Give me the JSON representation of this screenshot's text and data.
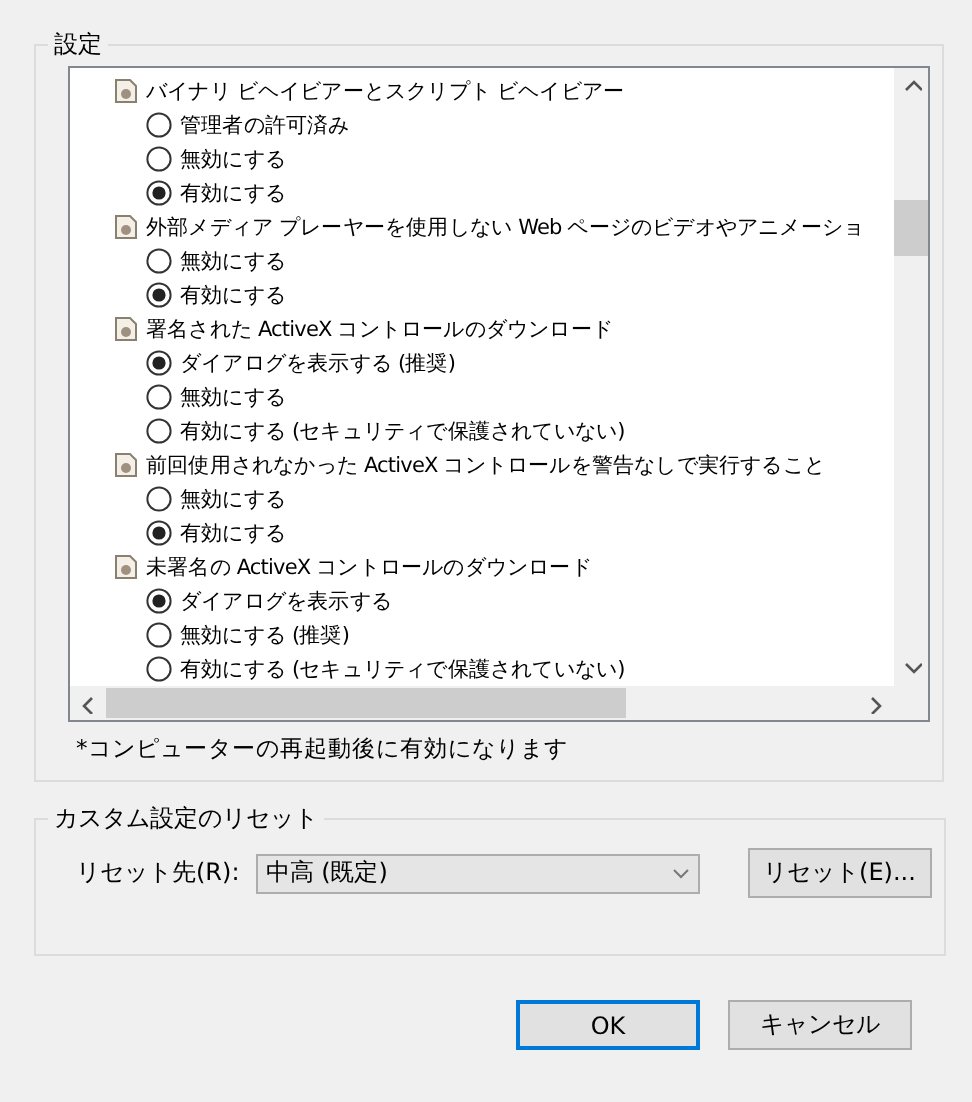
{
  "settings_group": {
    "title": "設定",
    "settings": [
      {
        "label": "バイナリ ビヘイビアーとスクリプト ビヘイビアー",
        "options": [
          {
            "label": "管理者の許可済み",
            "selected": false
          },
          {
            "label": "無効にする",
            "selected": false
          },
          {
            "label": "有効にする",
            "selected": true
          }
        ]
      },
      {
        "label": "外部メディア プレーヤーを使用しない Web ページのビデオやアニメーショ",
        "options": [
          {
            "label": "無効にする",
            "selected": false
          },
          {
            "label": "有効にする",
            "selected": true
          }
        ]
      },
      {
        "label": "署名された ActiveX コントロールのダウンロード",
        "options": [
          {
            "label": "ダイアログを表示する (推奨)",
            "selected": true
          },
          {
            "label": "無効にする",
            "selected": false
          },
          {
            "label": "有効にする (セキュリティで保護されていない)",
            "selected": false
          }
        ]
      },
      {
        "label": "前回使用されなかった ActiveX コントロールを警告なしで実行すること",
        "options": [
          {
            "label": "無効にする",
            "selected": false
          },
          {
            "label": "有効にする",
            "selected": true
          }
        ]
      },
      {
        "label": "未署名の ActiveX コントロールのダウンロード",
        "options": [
          {
            "label": "ダイアログを表示する",
            "selected": true
          },
          {
            "label": "無効にする (推奨)",
            "selected": false
          },
          {
            "label": "有効にする (セキュリティで保護されていない)",
            "selected": false
          }
        ]
      }
    ],
    "note": "*コンピューターの再起動後に有効になります"
  },
  "reset_group": {
    "title": "カスタム設定のリセット",
    "label": "リセット先(R):",
    "dropdown_value": "中高 (既定)",
    "button": "リセット(E)..."
  },
  "buttons": [
    {
      "label": "OK",
      "default": true
    },
    {
      "label": "キャンセル",
      "default": false
    }
  ]
}
